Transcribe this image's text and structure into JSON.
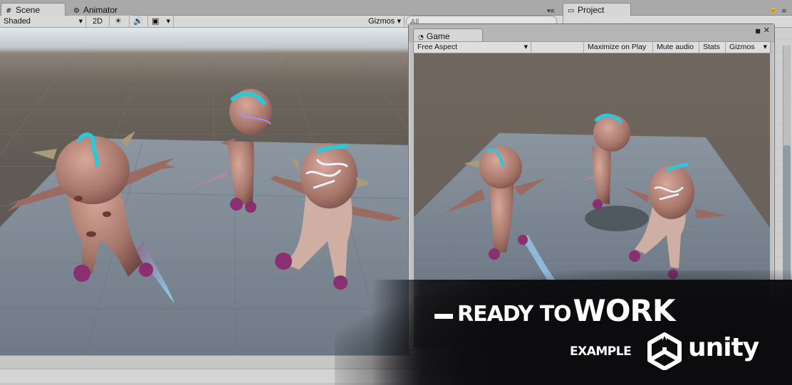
{
  "tabs": {
    "scene": "Scene",
    "animator": "Animator",
    "project": "Project"
  },
  "scene_toolbar": {
    "shading_mode": "Shaded",
    "mode_2d": "2D",
    "gizmos": "Gizmos",
    "search_placeholder": "All"
  },
  "game_window": {
    "tab": "Game",
    "aspect": "Free Aspect",
    "maximize": "Maximize on Play",
    "mute": "Mute audio",
    "stats": "Stats",
    "gizmos": "Gizmos"
  },
  "promo": {
    "headline_ready": "READY TO",
    "headline_work": "WORK",
    "example": "EXAMPLE",
    "brand": "unity"
  },
  "colors": {
    "creature_skin": "#a8776a",
    "creature_spots": "#6a3a35",
    "crest": "#2fc6d8",
    "glow": "#a98cff",
    "claws": "#8a2f6f",
    "floor": "#7f8b97"
  },
  "icons": [
    "hashtag-icon",
    "animator-icon",
    "folder-icon",
    "lock-icon",
    "menu-icon",
    "sun-icon",
    "speaker-icon",
    "image-icon",
    "close-icon",
    "maximize-icon"
  ]
}
